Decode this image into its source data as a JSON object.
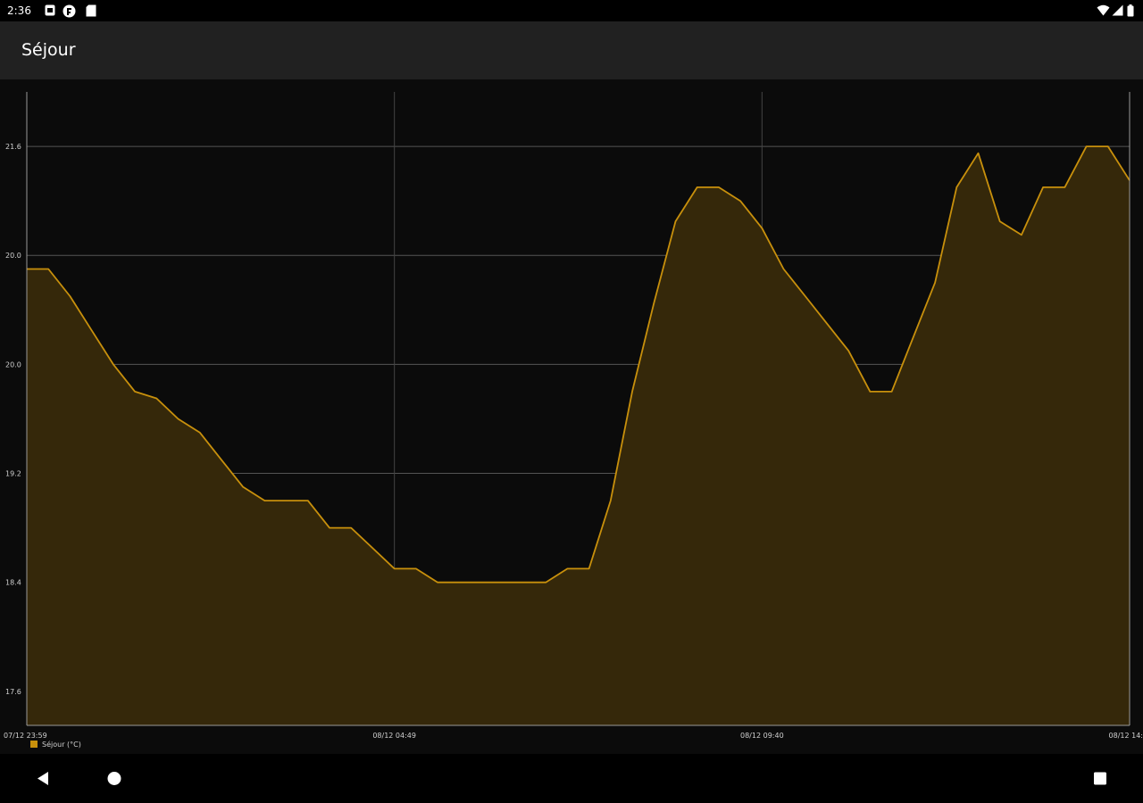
{
  "status_bar": {
    "time": "2:36",
    "icons": [
      "notification-square-icon",
      "app-circle-icon",
      "sd-card-icon",
      "wifi-icon",
      "signal-icon",
      "battery-icon"
    ]
  },
  "app_bar": {
    "title": "Séjour"
  },
  "colors": {
    "line": "#c8900c",
    "fill": "#35280a",
    "grid": "#555555",
    "vgrid": "#444444",
    "axis": "#9a9a9a",
    "label": "#d0d0d0"
  },
  "nav_bar": {
    "buttons": [
      "back-icon",
      "home-icon",
      "recents-icon"
    ]
  },
  "chart_data": {
    "type": "area",
    "y_ticks": [
      17.6,
      18.4,
      19.2,
      20.0,
      20.8,
      21.6
    ],
    "y_tick_labels": [
      "17.6",
      "18.4",
      "19.2",
      "20.0",
      "20.0",
      "21.6"
    ],
    "ylim": [
      17.35,
      22.0
    ],
    "x_tick_labels": [
      "07/12 23:59",
      "08/12 04:49",
      "08/12 09:40",
      "08/12 14:"
    ],
    "legend": {
      "label": "Séjour (°C)",
      "position": "bottom-left"
    },
    "grid": true,
    "series": [
      {
        "name": "Séjour (°C)",
        "values": [
          20.7,
          20.7,
          20.5,
          20.25,
          20.0,
          19.8,
          19.75,
          19.6,
          19.5,
          19.3,
          19.1,
          19.0,
          19.0,
          19.0,
          18.8,
          18.8,
          18.65,
          18.5,
          18.5,
          18.4,
          18.4,
          18.4,
          18.4,
          18.4,
          18.4,
          18.5,
          18.5,
          19.0,
          19.8,
          20.45,
          21.05,
          21.3,
          21.3,
          21.2,
          21.0,
          20.7,
          20.5,
          20.3,
          20.1,
          19.8,
          19.8,
          20.2,
          20.6,
          21.3,
          21.55,
          21.05,
          20.95,
          21.3,
          21.3,
          21.6,
          21.6,
          21.35
        ]
      }
    ]
  }
}
